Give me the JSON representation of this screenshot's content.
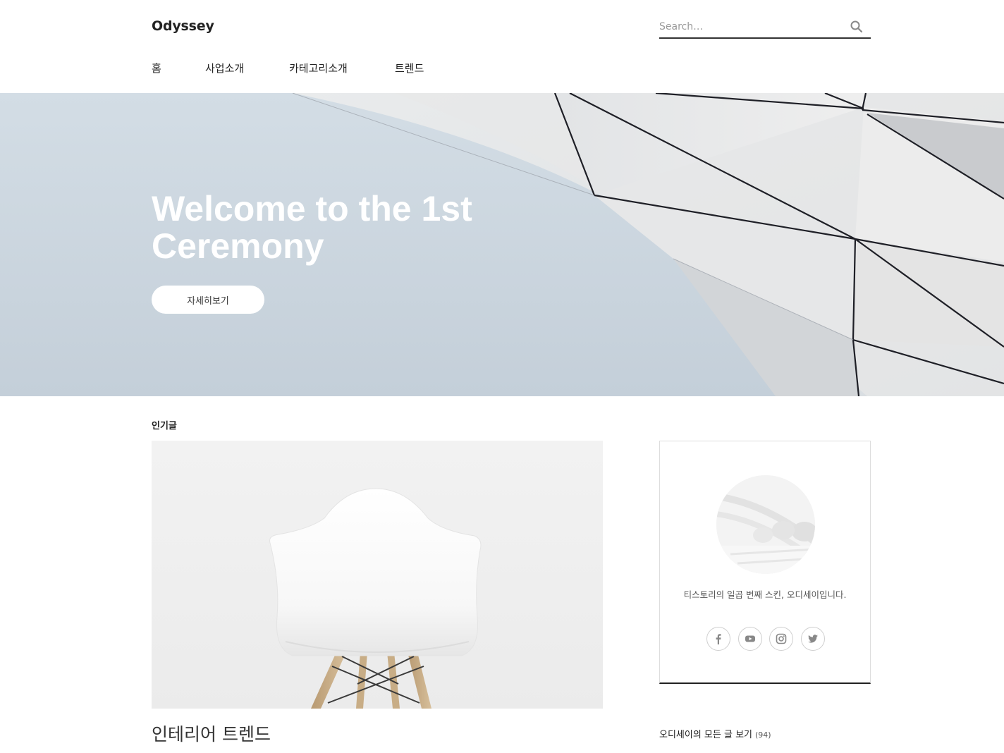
{
  "header": {
    "site_title": "Odyssey",
    "search_placeholder": "Search…"
  },
  "nav": {
    "items": [
      "홈",
      "사업소개",
      "카테고리소개",
      "트렌드"
    ]
  },
  "hero": {
    "title": "Welcome to the 1st Ceremony",
    "button_label": "자세히보기"
  },
  "popular": {
    "section_label": "인기글",
    "post_title": "인테리어 트렌드"
  },
  "sidebar": {
    "profile_description": "티스토리의 일곱 번째 스킨, 오디세이입니다.",
    "social_icons": [
      "facebook-icon",
      "youtube-icon",
      "instagram-icon",
      "twitter-icon"
    ],
    "all_posts_label": "오디세이의 모든 글 보기",
    "all_posts_count": "(94)"
  }
}
